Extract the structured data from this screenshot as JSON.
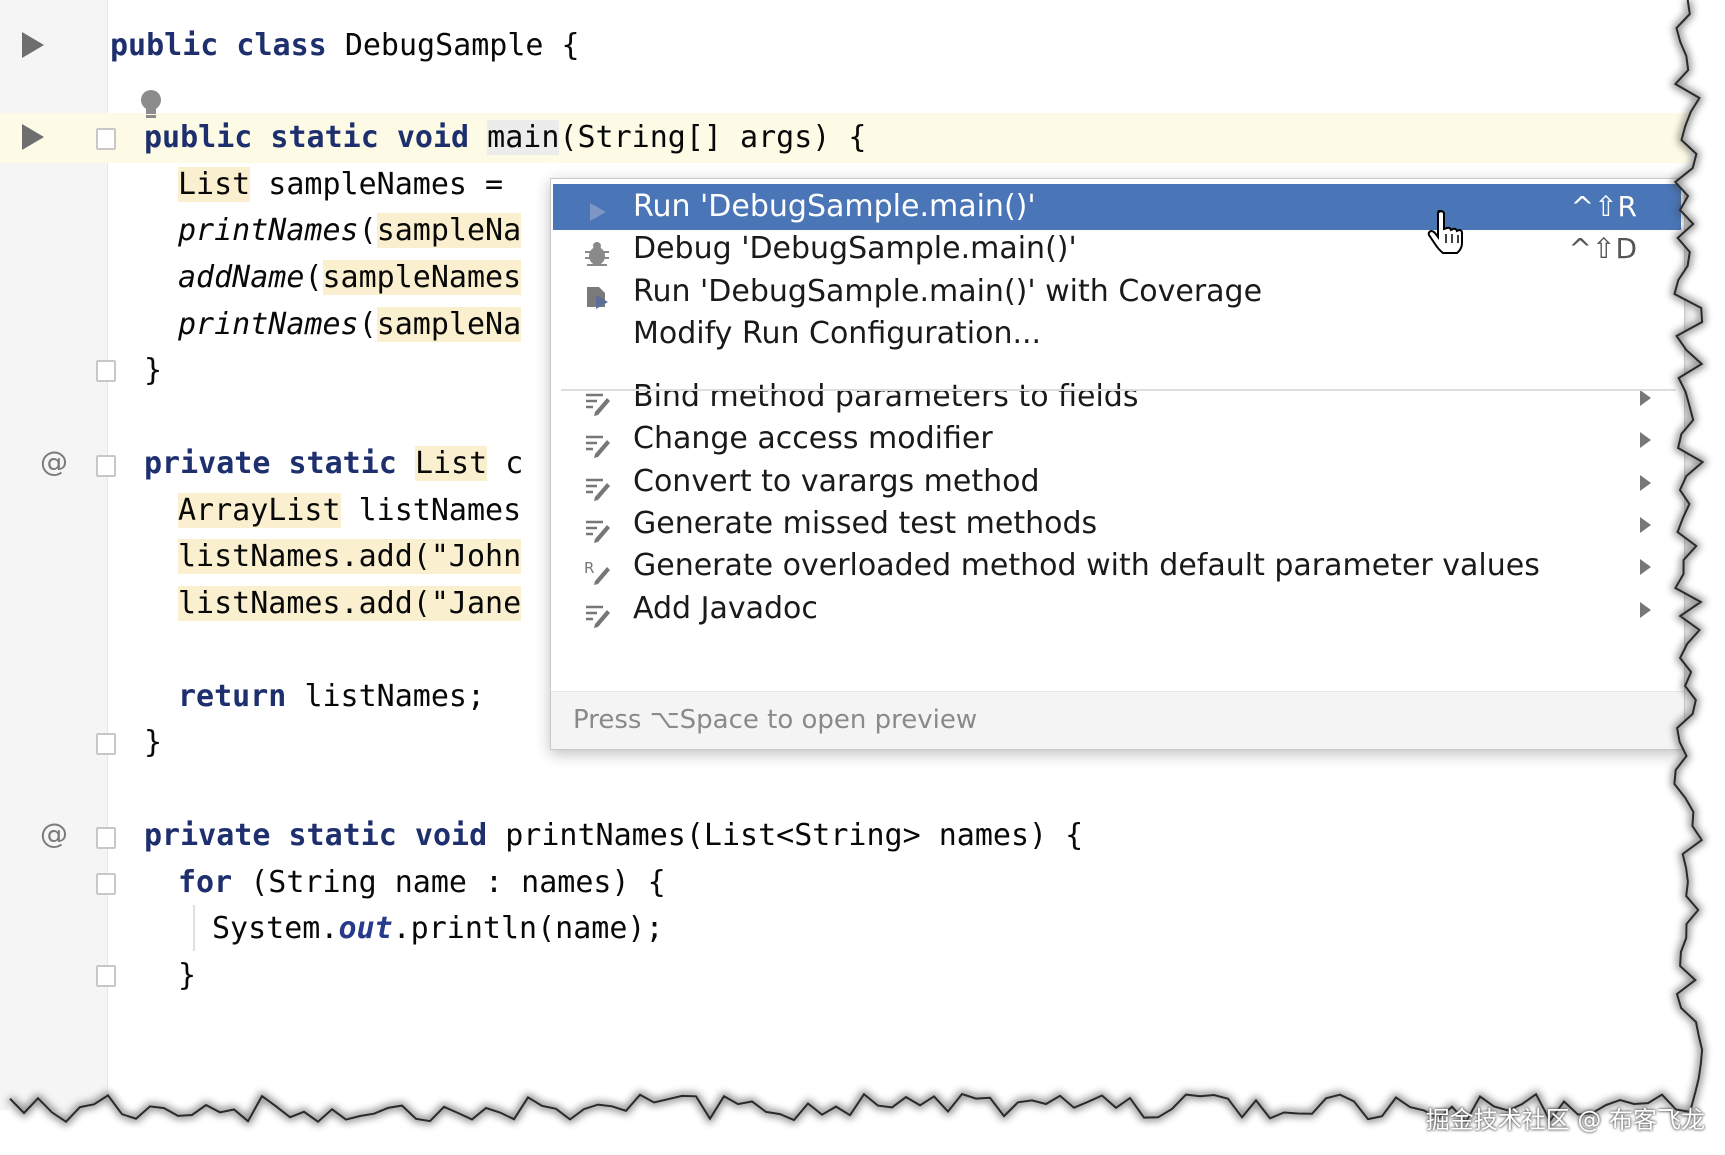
{
  "editor": {
    "lines": [
      {
        "id": "l1",
        "parts": [
          {
            "t": "public class ",
            "c": "kw"
          },
          {
            "t": "DebugSample {",
            "c": ""
          }
        ]
      },
      {
        "id": "l2",
        "parts": [
          {
            "t": "public static void ",
            "c": "kw"
          },
          {
            "t": "main",
            "c": "sel"
          },
          {
            "t": "(String[] args) {",
            "c": ""
          }
        ]
      },
      {
        "id": "l3",
        "parts": [
          {
            "t": "List",
            "c": "warn"
          },
          {
            "t": " sampleNames =",
            "c": ""
          }
        ]
      },
      {
        "id": "l4",
        "parts": [
          {
            "t": "printNames",
            "c": "it"
          },
          {
            "t": "(",
            "c": ""
          },
          {
            "t": "sampleNa",
            "c": "warn"
          }
        ]
      },
      {
        "id": "l5",
        "parts": [
          {
            "t": "addName",
            "c": "it"
          },
          {
            "t": "(",
            "c": ""
          },
          {
            "t": "sampleNames",
            "c": "warn"
          }
        ]
      },
      {
        "id": "l6",
        "parts": [
          {
            "t": "printNames",
            "c": "it"
          },
          {
            "t": "(",
            "c": ""
          },
          {
            "t": "sampleNa",
            "c": "warn"
          }
        ]
      },
      {
        "id": "l7",
        "parts": [
          {
            "t": "}",
            "c": ""
          }
        ]
      },
      {
        "id": "l8",
        "parts": [
          {
            "t": "private static ",
            "c": "kw"
          },
          {
            "t": "List",
            "c": "warn"
          },
          {
            "t": " c",
            "c": ""
          }
        ]
      },
      {
        "id": "l9",
        "parts": [
          {
            "t": "ArrayList",
            "c": "warn"
          },
          {
            "t": " listNames",
            "c": ""
          }
        ]
      },
      {
        "id": "l10",
        "parts": [
          {
            "t": "listNames.add(\"John",
            "c": "warn"
          }
        ]
      },
      {
        "id": "l11",
        "parts": [
          {
            "t": "listNames.add(\"Jane",
            "c": "warn"
          }
        ]
      },
      {
        "id": "l12",
        "parts": [
          {
            "t": "return ",
            "c": "kw"
          },
          {
            "t": "listNames;",
            "c": ""
          }
        ]
      },
      {
        "id": "l13",
        "parts": [
          {
            "t": "}",
            "c": ""
          }
        ]
      },
      {
        "id": "l14",
        "parts": [
          {
            "t": "private static void ",
            "c": "kw"
          },
          {
            "t": "printNames(List<String> names) {",
            "c": ""
          }
        ]
      },
      {
        "id": "l15",
        "parts": [
          {
            "t": "for ",
            "c": "kw"
          },
          {
            "t": "(String name : names) {",
            "c": ""
          }
        ]
      },
      {
        "id": "l16",
        "parts": [
          {
            "t": "System.",
            "c": ""
          },
          {
            "t": "out",
            "c": "it kw2"
          },
          {
            "t": ".println(name);",
            "c": ""
          }
        ]
      },
      {
        "id": "l17",
        "parts": [
          {
            "t": "}",
            "c": ""
          }
        ]
      }
    ]
  },
  "gutter": {
    "at_symbol": "@"
  },
  "popup": {
    "items": [
      {
        "label": "Run 'DebugSample.main()'",
        "shortcut": "^⇧R",
        "icon": "run-icon",
        "submenu": false,
        "active": true
      },
      {
        "label": "Debug 'DebugSample.main()'",
        "shortcut": "^⇧D",
        "icon": "debug-icon",
        "submenu": false,
        "active": false
      },
      {
        "label": "Run 'DebugSample.main()' with Coverage",
        "shortcut": "",
        "icon": "coverage-icon",
        "submenu": false,
        "active": false
      },
      {
        "label": "Modify Run Configuration...",
        "shortcut": "",
        "icon": "",
        "submenu": false,
        "active": false
      },
      {
        "label": "Bind method parameters to fields",
        "shortcut": "",
        "icon": "intention-icon",
        "submenu": true,
        "active": false
      },
      {
        "label": "Change access modifier",
        "shortcut": "",
        "icon": "intention-icon",
        "submenu": true,
        "active": false
      },
      {
        "label": "Convert to varargs method",
        "shortcut": "",
        "icon": "intention-icon",
        "submenu": true,
        "active": false
      },
      {
        "label": "Generate missed test methods",
        "shortcut": "",
        "icon": "intention-icon",
        "submenu": true,
        "active": false
      },
      {
        "label": "Generate overloaded method with default parameter values",
        "shortcut": "",
        "icon": "refactor-intention-icon",
        "submenu": true,
        "active": false
      },
      {
        "label": "Add Javadoc",
        "shortcut": "",
        "icon": "intention-icon",
        "submenu": true,
        "active": false
      }
    ],
    "footer": "Press ⌥Space to open preview"
  },
  "watermark": "掘金技术社区 @ 布客飞龙",
  "colors": {
    "active_item": "#4a75b7",
    "keyword": "#1e2f6e",
    "warning_highlight": "#faf0cf",
    "current_line": "#fdfbe5"
  }
}
